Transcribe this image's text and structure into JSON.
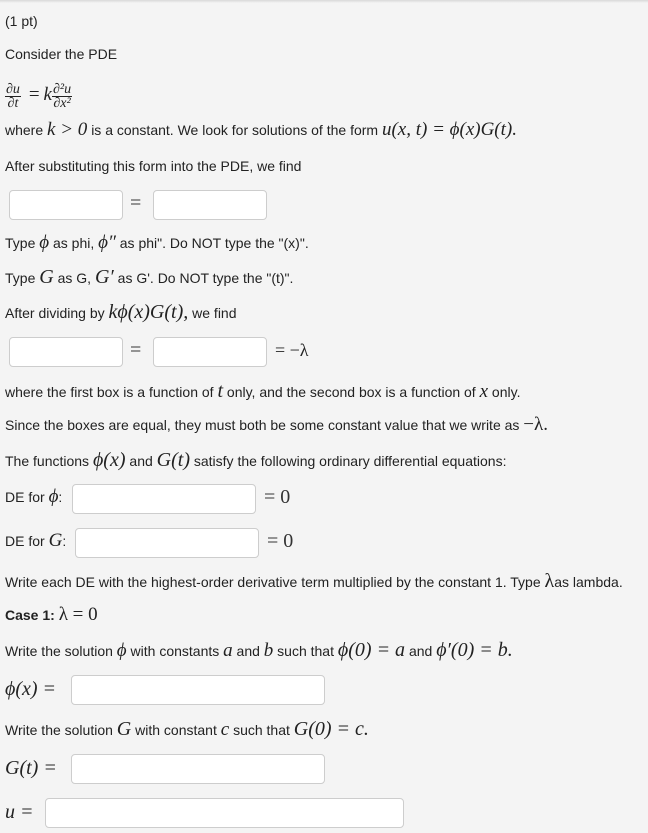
{
  "problem": {
    "points": "(1 pt)",
    "intro": "Consider the PDE",
    "pde": {
      "lhs_num": "∂u",
      "lhs_den": "∂t",
      "equals": "=",
      "coef": "k",
      "rhs_num": "∂²u",
      "rhs_den": "∂x²"
    },
    "where_line": {
      "t1": "where",
      "m1": "k > 0",
      "t2": "is a constant. We look for solutions of the form",
      "m2": "u(x, t) = ϕ(x)G(t)."
    },
    "after_sub": "After substituting this form into the PDE, we find",
    "type_phi": {
      "t1": "Type",
      "m1": "ϕ",
      "t2": "as phi,",
      "m2": "ϕ″",
      "t3": "as phi\". Do NOT type the \"(x)\"."
    },
    "type_G": {
      "t1": "Type",
      "m1": "G",
      "t2": "as G,",
      "m2": "G′",
      "t3": "as G'. Do NOT type the \"(t)\"."
    },
    "after_div": {
      "t1": "After dividing by",
      "m1": "kϕ(x)G(t),",
      "t2": "we find"
    },
    "eq_minus_lambda": "= −λ",
    "box_desc": {
      "t1": "where the first box is a function of",
      "m1": "t",
      "t2": "only, and the second box is a function of",
      "m2": "x",
      "t3": "only."
    },
    "since_line": {
      "t1": "Since the boxes are equal, they must both be some constant value that we write as",
      "m1": "−λ."
    },
    "functions_line": {
      "t1": "The functions",
      "m1": "ϕ(x)",
      "t2": "and",
      "m2": "G(t)",
      "t3": "satisfy the following ordinary differential equations:"
    },
    "de_phi": {
      "label": "DE for",
      "m": "ϕ",
      "colon": ":",
      "rhs": "= 0"
    },
    "de_G": {
      "label": "DE for",
      "m": "G",
      "colon": ":",
      "rhs": "= 0"
    },
    "write_each": {
      "t1": "Write each DE with the highest-order derivative term multiplied by the constant 1. Type",
      "m1": "λ",
      "t2": "as lambda."
    },
    "case1": {
      "label": "Case 1:",
      "m": "λ = 0"
    },
    "sol_phi_line": {
      "t1": "Write the solution",
      "m1": "ϕ",
      "t2": "with constants",
      "m2": "a",
      "t3": "and",
      "m3": "b",
      "t4": "such that",
      "m4": "ϕ(0) = a",
      "t5": "and",
      "m5": "ϕ′(0) = b."
    },
    "phi_x_label": "ϕ(x) =",
    "sol_G_line": {
      "t1": "Write the solution",
      "m1": "G",
      "t2": "with constant",
      "m2": "c",
      "t3": "such that",
      "m3": "G(0) = c."
    },
    "G_t_label": "G(t) =",
    "u_label": "u ="
  },
  "inputs": {
    "sub_left": "",
    "sub_right": "",
    "div_left": "",
    "div_right": "",
    "de_phi": "",
    "de_G": "",
    "phi_x": "",
    "G_t": "",
    "u": ""
  }
}
